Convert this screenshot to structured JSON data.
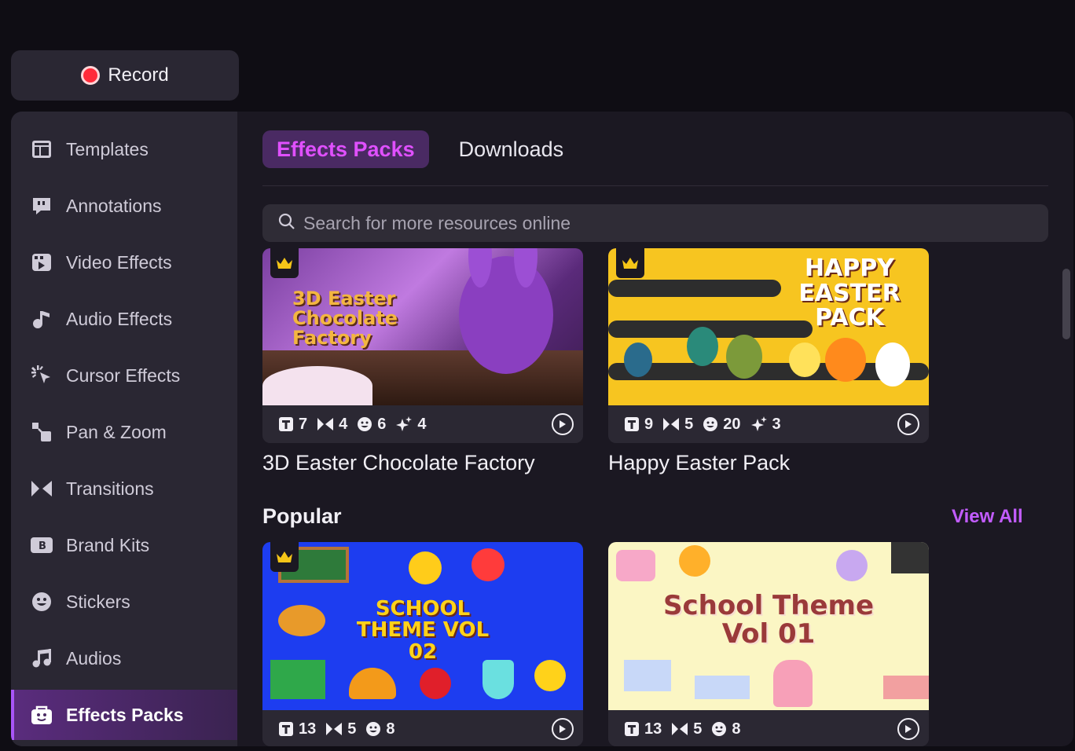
{
  "record": {
    "label": "Record"
  },
  "sidebar": {
    "items": [
      {
        "label": "Templates",
        "icon": "templates-icon"
      },
      {
        "label": "Annotations",
        "icon": "annotations-icon"
      },
      {
        "label": "Video Effects",
        "icon": "video-effects-icon"
      },
      {
        "label": "Audio Effects",
        "icon": "audio-effects-icon"
      },
      {
        "label": "Cursor Effects",
        "icon": "cursor-effects-icon"
      },
      {
        "label": "Pan & Zoom",
        "icon": "pan-zoom-icon"
      },
      {
        "label": "Transitions",
        "icon": "transitions-icon"
      },
      {
        "label": "Brand Kits",
        "icon": "brand-kits-icon"
      },
      {
        "label": "Stickers",
        "icon": "stickers-icon"
      },
      {
        "label": "Audios",
        "icon": "audios-icon"
      },
      {
        "label": "Effects Packs",
        "icon": "effects-packs-icon",
        "active": true
      }
    ]
  },
  "tabs": [
    {
      "label": "Effects Packs",
      "active": true
    },
    {
      "label": "Downloads",
      "active": false
    }
  ],
  "search": {
    "placeholder": "Search for more resources online"
  },
  "packs": [
    {
      "title": "3D Easter Chocolate Factory",
      "thumb_text": "3D Easter Chocolate Factory",
      "templates": "7",
      "transitions": "4",
      "stickers": "6",
      "effects": "4"
    },
    {
      "title": "Happy Easter Pack",
      "thumb_text": "HAPPY EASTER PACK",
      "templates": "9",
      "transitions": "5",
      "stickers": "20",
      "effects": "3"
    }
  ],
  "popular": {
    "title": "Popular",
    "view_all": "View All",
    "items": [
      {
        "thumb_text": "SCHOOL THEME VOL 02",
        "templates": "13",
        "transitions": "5",
        "stickers": "8"
      },
      {
        "thumb_text": "School Theme Vol 01",
        "templates": "13",
        "transitions": "5",
        "stickers": "8"
      }
    ]
  },
  "colors": {
    "accent": "#c25cff",
    "active_tab_bg": "#4a2a63",
    "record_red": "#ff2b3a"
  }
}
